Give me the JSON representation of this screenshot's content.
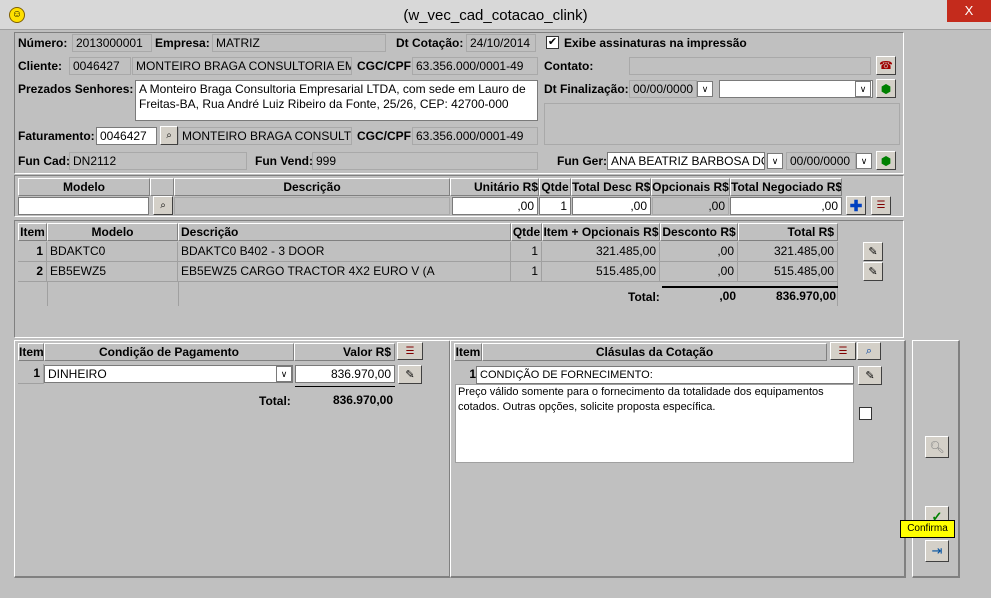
{
  "window": {
    "title": "(w_vec_cad_cotacao_clink)",
    "close": "X",
    "icon": "smiley-icon"
  },
  "header": {
    "numero_label": "Número:",
    "numero": "2013000001",
    "empresa_label": "Empresa:",
    "empresa": "MATRIZ",
    "dt_cotacao_label": "Dt Cotação:",
    "dt_cotacao": "24/10/2014",
    "exibe_label": "Exibe assinaturas na impressão",
    "exibe_checked": true,
    "cliente_label": "Cliente:",
    "cliente_codigo": "0046427",
    "cliente_nome": "MONTEIRO BRAGA CONSULTORIA EMF",
    "cgc_label": "CGC/CPF:",
    "cgc": "63.356.000/0001-49",
    "contato_label": "Contato:",
    "contato": "",
    "prezados_label": "Prezados Senhores:",
    "prezados_text": "A Monteiro Braga Consultoria Empresarial LTDA, com sede em Lauro de Freitas-BA, Rua André Luiz Ribeiro da Fonte, 25/26, CEP: 42700-000",
    "dt_final_label": "Dt Finalização:",
    "dt_final": "00/00/0000",
    "faturamento_label": "Faturamento:",
    "faturamento_codigo": "0046427",
    "faturamento_nome": "MONTEIRO BRAGA CONSULTC",
    "cgc2_label": "CGC/CPF:",
    "cgc2": "63.356.000/0001-49",
    "fun_cad_label": "Fun Cad:",
    "fun_cad": "DN2112",
    "fun_vend_label": "Fun Vend:",
    "fun_vend": "999",
    "fun_ger_label": "Fun Ger:",
    "fun_ger": "ANA BEATRIZ BARBOSA DO",
    "fun_ger_date": "00/00/0000"
  },
  "entry": {
    "headers": [
      "Modelo",
      "Descrição",
      "Unitário R$",
      "Qtde",
      "Total Desc R$",
      "Opcionais R$",
      "Total Negociado R$"
    ],
    "unitario": ",00",
    "qtde": "1",
    "total_desc": ",00",
    "opcionais": ",00",
    "total_neg": ",00"
  },
  "items": {
    "headers": [
      "Item",
      "Modelo",
      "Descrição",
      "Qtde",
      "Item + Opcionais R$",
      "Desconto R$",
      "Total R$"
    ],
    "rows": [
      {
        "item": "1",
        "modelo": "BDAKTC0",
        "descricao": "BDAKTC0 B402 - 3 DOOR",
        "qtde": "1",
        "item_opc": "321.485,00",
        "desconto": ",00",
        "total": "321.485,00"
      },
      {
        "item": "2",
        "modelo": "EB5EWZ5",
        "descricao": "EB5EWZ5 CARGO TRACTOR 4X2 EURO V (A",
        "qtde": "1",
        "item_opc": "515.485,00",
        "desconto": ",00",
        "total": "515.485,00"
      }
    ],
    "total_label": "Total:",
    "total_desconto": ",00",
    "total_geral": "836.970,00"
  },
  "payment": {
    "headers": [
      "Item",
      "Condição de Pagamento",
      "Valor R$"
    ],
    "row_item": "1",
    "row_condicao": "DINHEIRO",
    "row_valor": "836.970,00",
    "total_label": "Total:",
    "total": "836.970,00"
  },
  "clauses": {
    "headers": [
      "Item",
      "Clásulas da Cotação"
    ],
    "row_item": "1",
    "row_title": "CONDIÇÃO DE FORNECIMENTO:",
    "row_text": "Preço válido somente para o fornecimento da totalidade dos equipamentos cotados. Outras opções, solicite proposta específica."
  },
  "tooltip": "Confirma"
}
